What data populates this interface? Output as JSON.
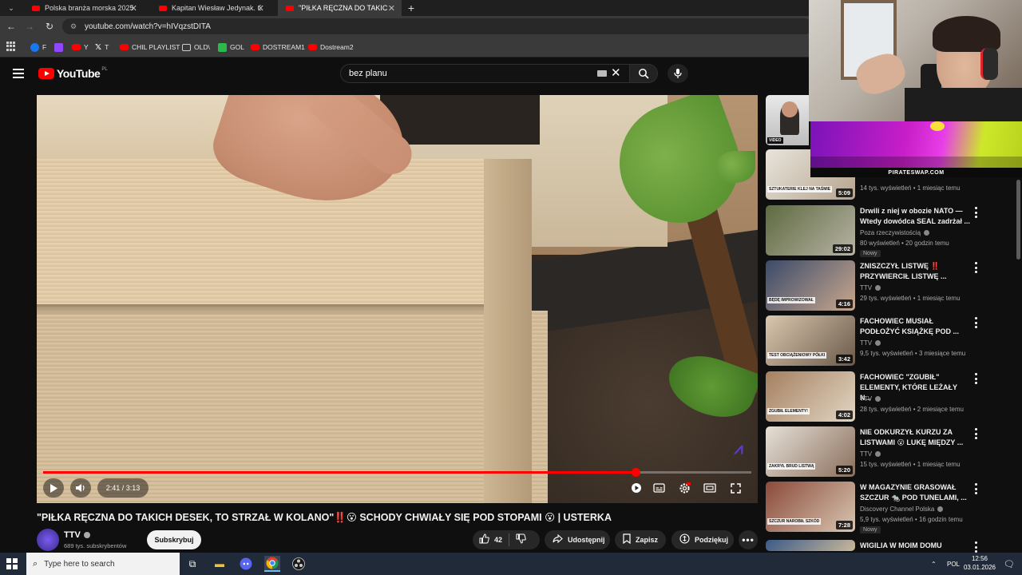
{
  "browser": {
    "tabs": [
      {
        "label": "Polska branża morska 2025 - Yo",
        "active": false
      },
      {
        "label": "Kapitan Wiesław Jedynak. Ostat",
        "active": false
      },
      {
        "label": "\"PIŁKA RĘCZNA DO TAKICH DE",
        "active": true
      }
    ],
    "url": "youtube.com/watch?v=hIVqzstDITA",
    "bookmarks": [
      {
        "label": "F",
        "icon": "facebook-icon"
      },
      {
        "label": "",
        "icon": "twitch-icon"
      },
      {
        "label": "Y",
        "icon": "youtube-icon"
      },
      {
        "label": "T",
        "icon": "x-icon"
      },
      {
        "label": "CHIL PLAYLIST",
        "icon": "youtube-icon"
      },
      {
        "label": "OLD\\",
        "icon": "folder-icon"
      },
      {
        "label": "GOL",
        "icon": "gol-icon"
      },
      {
        "label": "DOSTREAM1",
        "icon": "youtube-icon"
      },
      {
        "label": "Dostream2",
        "icon": "youtube-icon"
      }
    ]
  },
  "youtube": {
    "logo_text": "YouTube",
    "logo_country": "PL",
    "search_value": "bez planu"
  },
  "player": {
    "current_time": "2:41",
    "duration": "3:13",
    "time_display": "2:41 / 3:13",
    "progress_fraction": 0.836
  },
  "video": {
    "title": "\"PIŁKA RĘCZNA DO TAKICH DESEK, TO STRZAŁ W KOLANO\"‼️😮 SCHODY CHWIAŁY SIĘ POD STOPAMI 😮 | USTERKA",
    "channel": "TTV",
    "subscribers": "689 tys. subskrybentów",
    "subscribe_label": "Subskrybuj",
    "likes": "42",
    "share_label": "Udostępnij",
    "save_label": "Zapisz",
    "thanks_label": "Podziękuj"
  },
  "recommendations": [
    {
      "title": "",
      "channel": "",
      "meta": "14 tys. wyświetleń • 1 miesiąc temu",
      "duration": "5:09",
      "caption": "SZTUKATERIE KLEJ NA TAŚMIE",
      "badge": ""
    },
    {
      "title": "Drwili z niej w obozie NATO — Wtedy dowódca SEAL zadrżał ...",
      "channel": "Poza rzeczywistością",
      "meta": "80 wyświetleń • 20 godzin temu",
      "duration": "29:02",
      "caption": "",
      "badge": "Nowy"
    },
    {
      "title": "ZNISZCZYŁ LISTWĘ ‼️ PRZYWIERCIŁ LISTWĘ ...",
      "channel": "TTV",
      "meta": "29 tys. wyświetleń • 1 miesiąc temu",
      "duration": "4:16",
      "caption": "BĘDĘ IMPROWIZOWAŁ",
      "badge": ""
    },
    {
      "title": "FACHOWIEC MUSIAŁ PODŁOŻYĆ KSIĄŻKĘ POD ...",
      "channel": "TTV",
      "meta": "9,5 tys. wyświetleń • 3 miesiące temu",
      "duration": "3:42",
      "caption": "TEST OBCIĄŻENIOWY PÓŁKI",
      "badge": ""
    },
    {
      "title": "FACHOWIEC \"ZGUBIŁ\" ELEMENTY, KTÓRE LEŻAŁY N...",
      "channel": "TTV",
      "meta": "28 tys. wyświetleń • 2 miesiące temu",
      "duration": "4:02",
      "caption": "ZGUBIŁ ELEMENTY!",
      "badge": ""
    },
    {
      "title": "NIE ODKURZYŁ KURZU ZA LISTWAMI 😮 LUKĘ MIĘDZY ...",
      "channel": "TTV",
      "meta": "15 tys. wyświetleń • 1 miesiąc temu",
      "duration": "5:20",
      "caption": "ZAKRYŁ BRUD LISTWĄ",
      "badge": ""
    },
    {
      "title": "W MAGAZYNIE GRASOWAŁ SZCZUR 🐀 POD TUNELAMI, ...",
      "channel": "Discovery Channel Polska",
      "meta": "5,9 tys. wyświetleń • 16 godzin temu",
      "duration": "7:28",
      "caption": "SZCZUR NAROBIŁ SZKÓD",
      "badge": "Nowy"
    },
    {
      "title": "WIGILIA W MOIM DOMU",
      "channel": "",
      "meta": "",
      "duration": "",
      "caption": "",
      "badge": ""
    }
  ],
  "overlay": {
    "banner_text": "PIRATESWAP.COM",
    "top_thumb_tag": "VIDEO"
  },
  "taskbar": {
    "search_placeholder": "Type here to search",
    "language": "POL",
    "time": "12:56",
    "date": "03.01.2026"
  }
}
